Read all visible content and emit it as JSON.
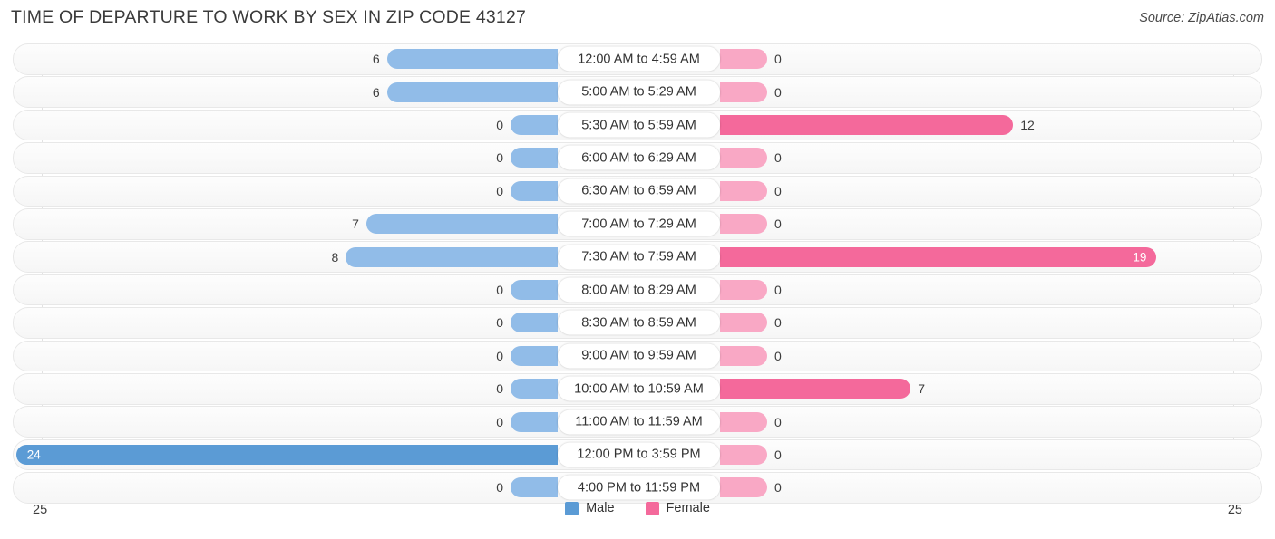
{
  "header": {
    "title": "TIME OF DEPARTURE TO WORK BY SEX IN ZIP CODE 43127",
    "source": "Source: ZipAtlas.com"
  },
  "legend": {
    "male_label": "Male",
    "female_label": "Female",
    "male_color": "#5b9bd5",
    "female_color": "#f4699b"
  },
  "axis": {
    "left_end": "25",
    "right_end": "25",
    "max": 25
  },
  "chart_data": {
    "type": "bar",
    "orientation": "horizontal-diverging",
    "title": "TIME OF DEPARTURE TO WORK BY SEX IN ZIP CODE 43127",
    "xlabel": "",
    "ylabel": "",
    "xlim": [
      25,
      25
    ],
    "grid": false,
    "legend_position": "bottom-center",
    "categories": [
      "12:00 AM to 4:59 AM",
      "5:00 AM to 5:29 AM",
      "5:30 AM to 5:59 AM",
      "6:00 AM to 6:29 AM",
      "6:30 AM to 6:59 AM",
      "7:00 AM to 7:29 AM",
      "7:30 AM to 7:59 AM",
      "8:00 AM to 8:29 AM",
      "8:30 AM to 8:59 AM",
      "9:00 AM to 9:59 AM",
      "10:00 AM to 10:59 AM",
      "11:00 AM to 11:59 AM",
      "12:00 PM to 3:59 PM",
      "4:00 PM to 11:59 PM"
    ],
    "series": [
      {
        "name": "Male",
        "color": "#5b9bd5",
        "values": [
          6,
          6,
          0,
          0,
          0,
          7,
          8,
          0,
          0,
          0,
          0,
          0,
          24,
          0
        ]
      },
      {
        "name": "Female",
        "color": "#f4699b",
        "values": [
          0,
          0,
          12,
          0,
          0,
          0,
          19,
          0,
          0,
          0,
          7,
          0,
          0,
          0
        ]
      }
    ]
  },
  "rows": [
    {
      "category": "12:00 AM to 4:59 AM",
      "male": "6",
      "female": "0"
    },
    {
      "category": "5:00 AM to 5:29 AM",
      "male": "6",
      "female": "0"
    },
    {
      "category": "5:30 AM to 5:59 AM",
      "male": "0",
      "female": "12"
    },
    {
      "category": "6:00 AM to 6:29 AM",
      "male": "0",
      "female": "0"
    },
    {
      "category": "6:30 AM to 6:59 AM",
      "male": "0",
      "female": "0"
    },
    {
      "category": "7:00 AM to 7:29 AM",
      "male": "7",
      "female": "0"
    },
    {
      "category": "7:30 AM to 7:59 AM",
      "male": "8",
      "female": "19"
    },
    {
      "category": "8:00 AM to 8:29 AM",
      "male": "0",
      "female": "0"
    },
    {
      "category": "8:30 AM to 8:59 AM",
      "male": "0",
      "female": "0"
    },
    {
      "category": "9:00 AM to 9:59 AM",
      "male": "0",
      "female": "0"
    },
    {
      "category": "10:00 AM to 10:59 AM",
      "male": "0",
      "female": "7"
    },
    {
      "category": "11:00 AM to 11:59 AM",
      "male": "0",
      "female": "0"
    },
    {
      "category": "12:00 PM to 3:59 PM",
      "male": "24",
      "female": "0"
    },
    {
      "category": "4:00 PM to 11:59 PM",
      "male": "0",
      "female": "0"
    }
  ]
}
